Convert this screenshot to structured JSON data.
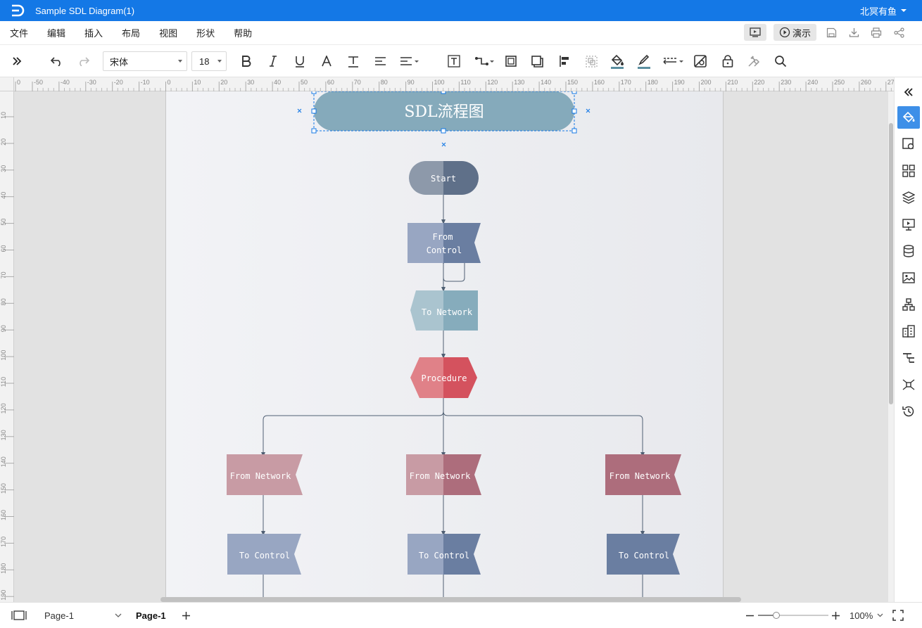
{
  "app": {
    "document_title": "Sample SDL Diagram(1)",
    "user_name": "北冥有鱼"
  },
  "menu": {
    "items": [
      "文件",
      "编辑",
      "插入",
      "布局",
      "视图",
      "形状",
      "帮助"
    ],
    "present_label": "演示"
  },
  "toolbar": {
    "font_family": "宋体",
    "font_size": "18"
  },
  "rulers": {
    "horizontal_ticks": [
      "0",
      "-50",
      "-40",
      "-30",
      "-20",
      "-10",
      "0",
      "10",
      "20",
      "30",
      "40",
      "50",
      "60",
      "70",
      "80",
      "90",
      "100",
      "110",
      "120",
      "130",
      "140",
      "150",
      "160",
      "170",
      "180",
      "190",
      "200",
      "210",
      "220",
      "230",
      "240",
      "250",
      "260",
      "270"
    ],
    "vertical_ticks": [
      "10",
      "20",
      "30",
      "40",
      "50",
      "60",
      "70",
      "80",
      "90",
      "100",
      "110",
      "120",
      "130",
      "140",
      "150",
      "160",
      "170",
      "180",
      "190"
    ]
  },
  "diagram": {
    "title": "SDL流程图",
    "shapes": {
      "start": "Start",
      "from_control": "From Control",
      "to_network": "To Network",
      "procedure": "Procedure",
      "from_network_left": "From Network",
      "from_network_mid": "From Network",
      "from_network_right": "From Network",
      "to_control_left": "To Control",
      "to_control_mid": "To Control",
      "to_control_right": "To Control"
    },
    "colors": {
      "title_fill": "#85aabb",
      "start_fill": "#8d99aa",
      "start_fill_dark": "#5f7089",
      "control_fill": "#98a6c2",
      "control_fill_dark": "#6a7ea1",
      "network_fill": "#aac4cf",
      "network_fill_dark": "#86acbc",
      "procedure_fill": "#e08188",
      "procedure_fill_dark": "#d4525e",
      "from_network_fill": "#c89ba4",
      "from_network_fill_dark": "#ad6d7c",
      "connector": "#4f5f73",
      "selection": "#1478e6"
    }
  },
  "statusbar": {
    "page_dropdown": "Page-1",
    "active_tab": "Page-1",
    "zoom": "100%"
  }
}
